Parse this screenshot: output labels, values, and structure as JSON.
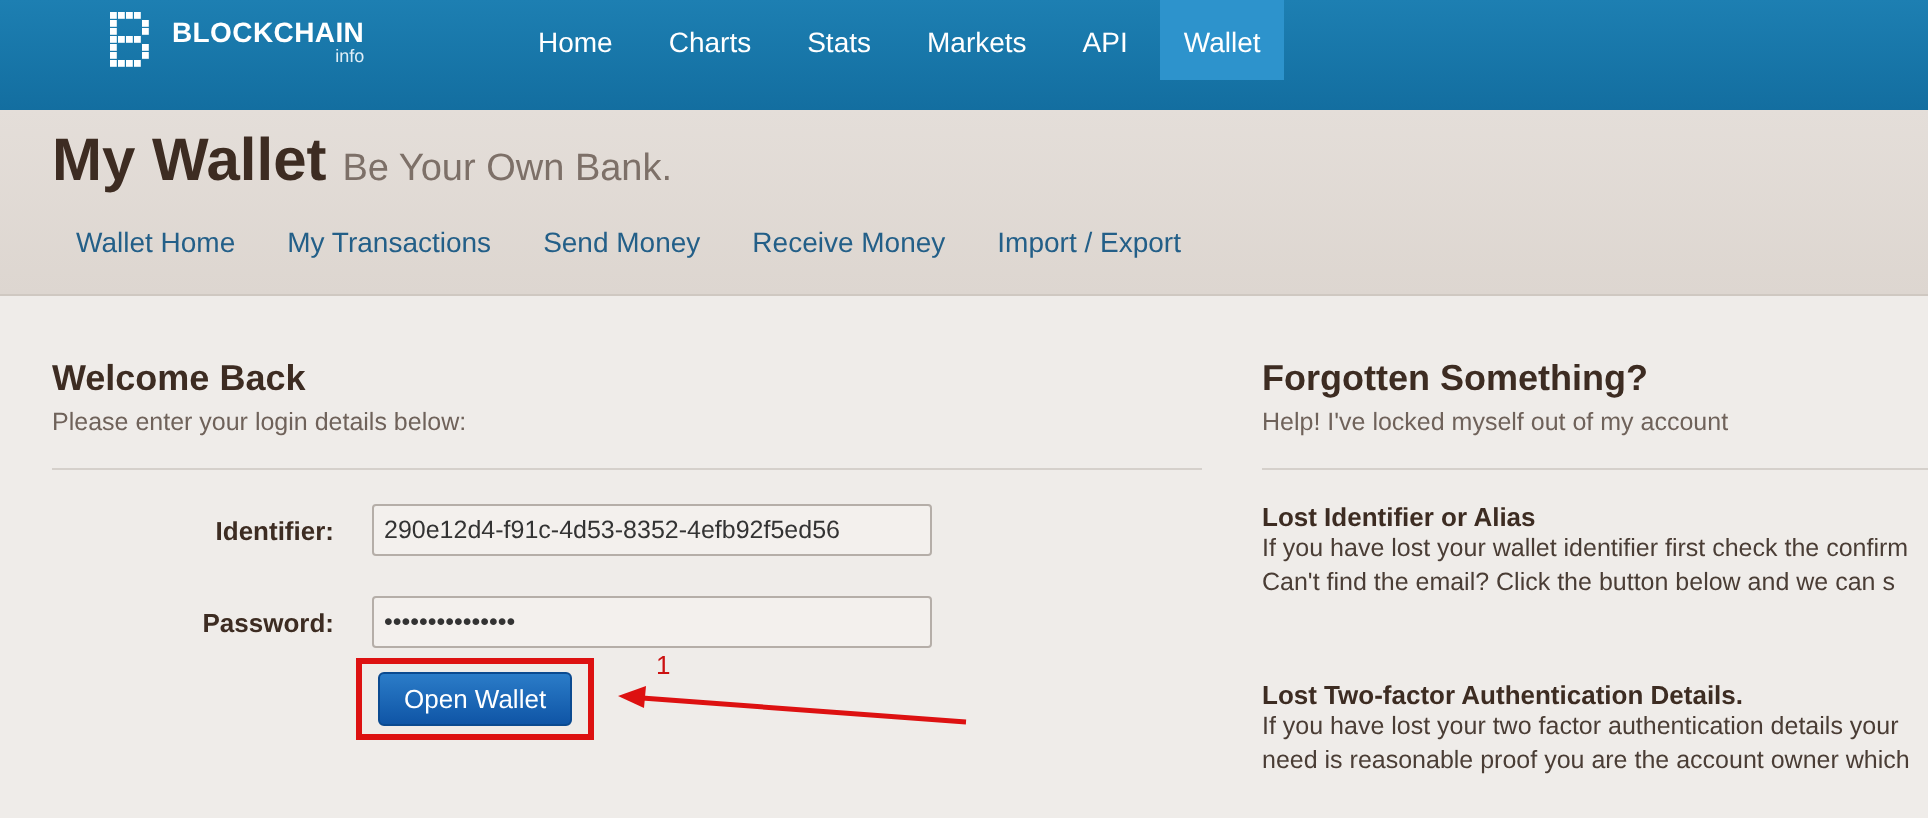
{
  "brand": {
    "name": "BLOCKCHAIN",
    "suffix": "info"
  },
  "nav": [
    {
      "label": "Home",
      "selected": false
    },
    {
      "label": "Charts",
      "selected": false
    },
    {
      "label": "Stats",
      "selected": false
    },
    {
      "label": "Markets",
      "selected": false
    },
    {
      "label": "API",
      "selected": false
    },
    {
      "label": "Wallet",
      "selected": true
    }
  ],
  "header": {
    "title": "My Wallet",
    "tagline": "Be Your Own Bank."
  },
  "subnav": [
    "Wallet Home",
    "My Transactions",
    "Send Money",
    "Receive Money",
    "Import / Export"
  ],
  "login": {
    "title": "Welcome Back",
    "subtitle": "Please enter your login details below:",
    "fields": [
      {
        "label": "Identifier:",
        "value": "290e12d4-f91c-4d53-8352-4efb92f5ed56"
      },
      {
        "label": "Password:",
        "value": "•••••••••••••••"
      }
    ],
    "button": "Open Wallet",
    "annotation": "1"
  },
  "help": {
    "title": "Forgotten Something?",
    "subtitle": "Help! I've locked myself out of my account",
    "sections": [
      {
        "title": "Lost Identifier or Alias",
        "lines": [
          "If you have lost your wallet identifier first check the confirm",
          "Can't find the email? Click the button below and we can s"
        ]
      },
      {
        "title": "Lost Two-factor Authentication Details.",
        "lines": [
          "If you have lost your two factor authentication details your",
          "need is reasonable proof you are the account owner which"
        ]
      }
    ]
  }
}
